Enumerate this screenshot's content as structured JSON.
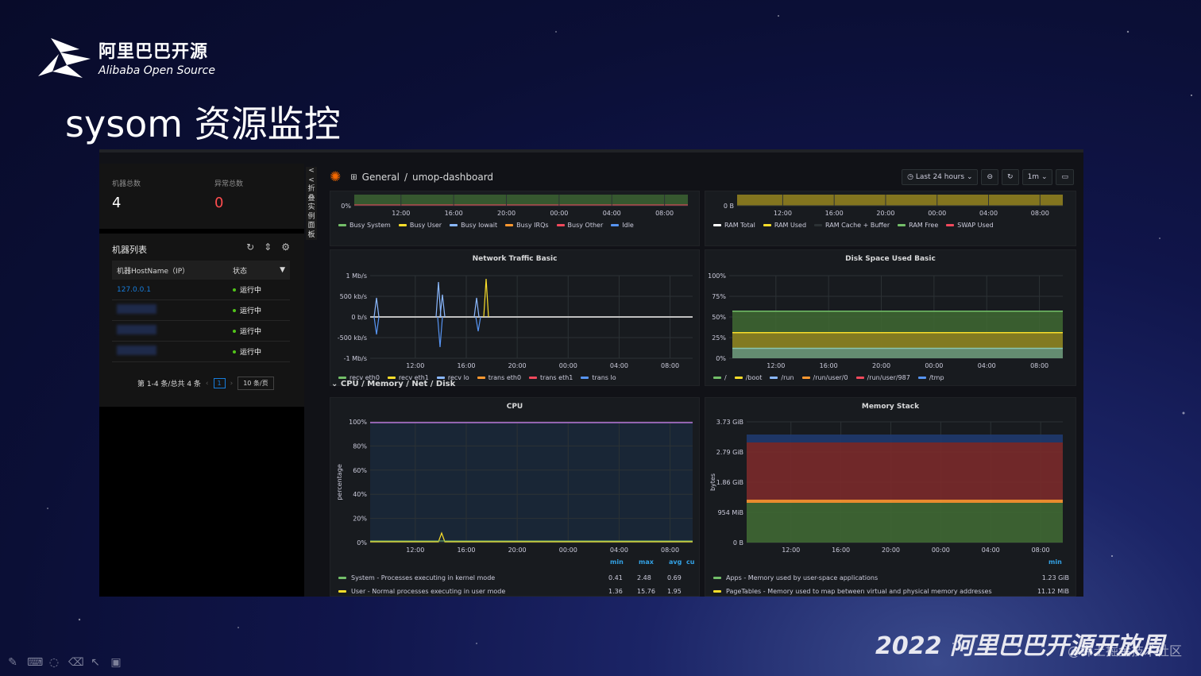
{
  "brand": {
    "cn": "阿里巴巴开源",
    "en": "Alibaba Open Source"
  },
  "slide_title": "sysom 资源监控",
  "footer_brand": "2022 阿里巴巴开源开放周",
  "watermark": "@稀土掘金技术社区",
  "stats": {
    "machines_label": "机器总数",
    "machines_value": "4",
    "abnormal_label": "异常总数",
    "abnormal_value": "0"
  },
  "machine_list": {
    "title": "机器列表",
    "col_host": "机器HostName（IP）",
    "col_status": "状态",
    "rows": [
      {
        "host": "127.0.0.1",
        "status": "运行中"
      },
      {
        "host": "",
        "status": "运行中"
      },
      {
        "host": "",
        "status": "运行中"
      },
      {
        "host": "",
        "status": "运行中"
      }
    ],
    "pager_summary": "第 1-4 条/总共 4 条",
    "pager_current": "1",
    "pager_size": "10 条/页"
  },
  "collapse_label": "<<折叠实例面板",
  "grafana": {
    "crumb_folder": "General",
    "crumb_sep": "/",
    "crumb_dashboard": "umop-dashboard",
    "time_range": "Last 24 hours",
    "refresh": "1m",
    "row_header": "CPU / Memory / Net / Disk",
    "colors": {
      "green": "#73bf69",
      "yellow": "#fade2a",
      "blue": "#5794f2",
      "orange": "#ff9830",
      "red": "#f2495c",
      "purple": "#b877d9",
      "cyan": "#8ab8ff"
    }
  },
  "chart_data": [
    {
      "type": "area",
      "title": "",
      "x": [
        "12:00",
        "16:00",
        "20:00",
        "00:00",
        "04:00",
        "08:00"
      ],
      "yticks": [
        "0%"
      ],
      "series": [
        {
          "name": "Busy System"
        },
        {
          "name": "Busy User"
        },
        {
          "name": "Busy Iowait"
        },
        {
          "name": "Busy IRQs"
        },
        {
          "name": "Busy Other"
        },
        {
          "name": "Idle"
        }
      ]
    },
    {
      "type": "area",
      "title": "",
      "x": [
        "12:00",
        "16:00",
        "20:00",
        "00:00",
        "04:00",
        "08:00"
      ],
      "yticks": [
        "0 B"
      ],
      "series": [
        {
          "name": "RAM Total"
        },
        {
          "name": "RAM Used"
        },
        {
          "name": "RAM Cache + Buffer"
        },
        {
          "name": "RAM Free"
        },
        {
          "name": "SWAP Used"
        }
      ]
    },
    {
      "type": "line",
      "title": "Network Traffic Basic",
      "x": [
        "12:00",
        "16:00",
        "20:00",
        "00:00",
        "04:00",
        "08:00"
      ],
      "yticks": [
        "1 Mb/s",
        "500 kb/s",
        "0 b/s",
        "-500 kb/s",
        "-1 Mb/s"
      ],
      "ylim": [
        -1,
        1
      ],
      "series": [
        {
          "name": "recv eth0"
        },
        {
          "name": "recv eth1"
        },
        {
          "name": "recv lo"
        },
        {
          "name": "trans eth0"
        },
        {
          "name": "trans eth1"
        },
        {
          "name": "trans lo"
        }
      ]
    },
    {
      "type": "area",
      "title": "Disk Space Used Basic",
      "x": [
        "12:00",
        "16:00",
        "20:00",
        "00:00",
        "04:00",
        "08:00"
      ],
      "yticks": [
        "100%",
        "75%",
        "50%",
        "25%",
        "0%"
      ],
      "ylim": [
        0,
        100
      ],
      "series": [
        {
          "name": "/",
          "values": [
            57,
            57,
            57,
            57,
            57,
            57
          ]
        },
        {
          "name": "/boot",
          "values": [
            31,
            31,
            31,
            31,
            31,
            31
          ]
        },
        {
          "name": "/run",
          "values": [
            12,
            12,
            12,
            12,
            12,
            12
          ]
        },
        {
          "name": "/run/user/0"
        },
        {
          "name": "/run/user/987"
        },
        {
          "name": "/tmp"
        }
      ]
    },
    {
      "type": "area",
      "title": "CPU",
      "ylabel": "percentage",
      "x": [
        "12:00",
        "16:00",
        "20:00",
        "00:00",
        "04:00",
        "08:00"
      ],
      "yticks": [
        "100%",
        "80%",
        "60%",
        "40%",
        "20%",
        "0%"
      ],
      "ylim": [
        0,
        100
      ],
      "legend_headers": [
        "min",
        "max",
        "avg",
        "cu"
      ],
      "series": [
        {
          "name": "System - Processes executing in kernel mode",
          "min": "0.41",
          "max": "2.48",
          "avg": "0.69"
        },
        {
          "name": "User - Normal processes executing in user mode",
          "min": "1.36",
          "max": "15.76",
          "avg": "1.95"
        }
      ]
    },
    {
      "type": "area",
      "title": "Memory Stack",
      "ylabel": "bytes",
      "x": [
        "12:00",
        "16:00",
        "20:00",
        "00:00",
        "04:00",
        "08:00"
      ],
      "yticks": [
        "3.73 GiB",
        "2.79 GiB",
        "1.86 GiB",
        "954 MiB",
        "0 B"
      ],
      "legend_headers": [
        "min"
      ],
      "series": [
        {
          "name": "Apps - Memory used by user-space applications",
          "min": "1.23 GiB"
        },
        {
          "name": "PageTables - Memory used to map between virtual and physical memory addresses",
          "min": "11.12 MiB"
        }
      ]
    }
  ]
}
